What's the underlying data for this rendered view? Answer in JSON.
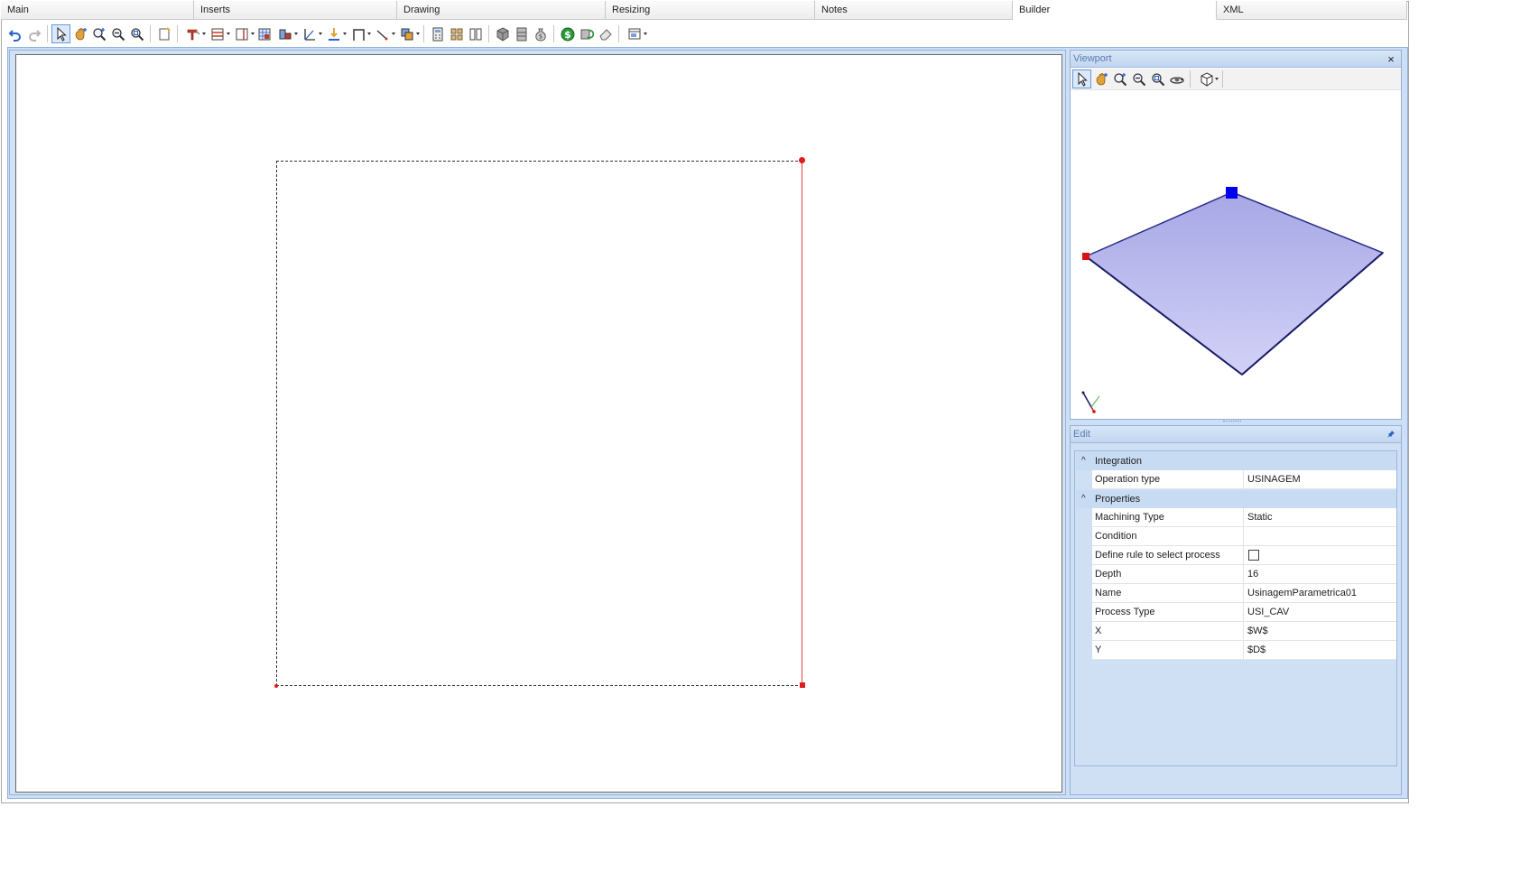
{
  "tabs": [
    {
      "label": "Main",
      "active": false
    },
    {
      "label": "Inserts",
      "active": false
    },
    {
      "label": "Drawing",
      "active": false
    },
    {
      "label": "Resizing",
      "active": false
    },
    {
      "label": "Notes",
      "active": false
    },
    {
      "label": "Builder",
      "active": true
    },
    {
      "label": "XML",
      "active": false
    }
  ],
  "toolbar": {
    "icons": [
      "undo-icon",
      "redo-icon",
      "select-pointer-icon",
      "pan-hand-icon",
      "zoom-window-icon",
      "zoom-out-icon",
      "zoom-extents-icon",
      "new-note-icon",
      "insert-tool-icon",
      "panel-icon",
      "divider-icon",
      "grid-icon",
      "connector-icon",
      "angle-icon",
      "arrow-down-icon",
      "frame-icon",
      "line-icon",
      "copy-icon",
      "calculator-icon",
      "hardware-icon",
      "columns-icon",
      "cube-icon",
      "cabinet-icon",
      "money-bag-icon",
      "dollar-icon",
      "refresh-icon",
      "eraser-icon",
      "layout-icon"
    ]
  },
  "viewport": {
    "title": "Viewport",
    "close_glyph": "×",
    "colors": {
      "plane_fill": "#b8b8f0",
      "plane_edge": "#2b2b8a",
      "handle_blue": "#0000ee",
      "handle_red": "#dd1111"
    }
  },
  "edit": {
    "title": "Edit",
    "pin_glyph": "📌",
    "categories": [
      {
        "label": "Integration",
        "rows": [
          {
            "key": "Operation type",
            "value": "USINAGEM"
          }
        ]
      },
      {
        "label": "Properties",
        "rows": [
          {
            "key": "Machining Type",
            "value": "Static"
          },
          {
            "key": "Condition",
            "value": ""
          },
          {
            "key": "Define rule to select process",
            "value": "",
            "checkbox": true,
            "checked": false
          },
          {
            "key": "Depth",
            "value": "16"
          },
          {
            "key": "Name",
            "value": "UsinagemParametrica01"
          },
          {
            "key": "Process Type",
            "value": "USI_CAV"
          },
          {
            "key": "X",
            "value": "$W$"
          },
          {
            "key": "Y",
            "value": "$D$"
          }
        ]
      }
    ]
  },
  "colors": {
    "accent": "#8fb0dd",
    "selection_edge": "#e04040",
    "panel_bg": "#cfe0f5"
  }
}
